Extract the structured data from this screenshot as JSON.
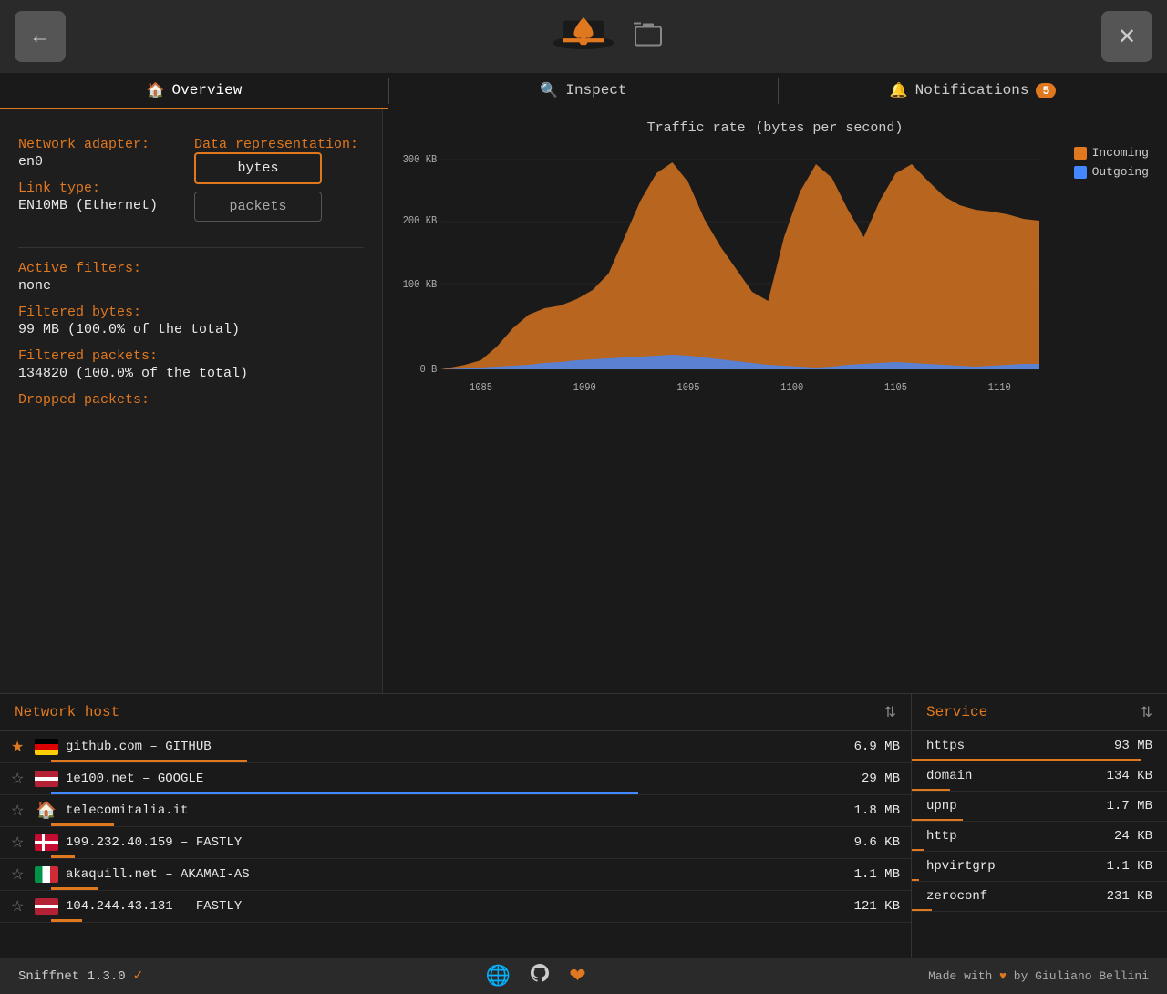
{
  "header": {
    "back_button_label": "←",
    "settings_button_label": "✕",
    "capture_icon_label": "⊞"
  },
  "tabs": [
    {
      "id": "overview",
      "label": "Overview",
      "icon": "🏠",
      "active": true,
      "badge": null
    },
    {
      "id": "inspect",
      "label": "Inspect",
      "icon": "🔍",
      "active": false,
      "badge": null
    },
    {
      "id": "notifications",
      "label": "Notifications",
      "icon": "🔔",
      "active": false,
      "badge": "5"
    }
  ],
  "left_panel": {
    "network_adapter_label": "Network adapter:",
    "network_adapter_value": "en0",
    "link_type_label": "Link type:",
    "link_type_value": "EN10MB (Ethernet)",
    "data_representation_label": "Data representation:",
    "bytes_btn": "bytes",
    "packets_btn": "packets",
    "active_filters_label": "Active filters:",
    "active_filters_value": "none",
    "filtered_bytes_label": "Filtered bytes:",
    "filtered_bytes_value": "99 MB (100.0% of the total)",
    "filtered_packets_label": "Filtered packets:",
    "filtered_packets_value": "134820 (100.0% of the total)",
    "dropped_packets_label": "Dropped packets:"
  },
  "chart": {
    "title": "Traffic rate",
    "subtitle": "(bytes per second)",
    "legend": [
      {
        "label": "Incoming",
        "color": "#e07820"
      },
      {
        "label": "Outgoing",
        "color": "#4488ff"
      }
    ],
    "y_labels": [
      "300 KB",
      "200 KB",
      "100 KB",
      "0 B"
    ],
    "x_labels": [
      "1085",
      "1090",
      "1095",
      "1100",
      "1105",
      "1110"
    ]
  },
  "network_hosts": {
    "title": "Network host",
    "rows": [
      {
        "starred": true,
        "flag": "de",
        "name": "github.com – GITHUB",
        "size": "6.9 MB",
        "bar_pct": 25,
        "bar_type": "orange"
      },
      {
        "starred": false,
        "flag": "us",
        "name": "1e100.net – GOOGLE",
        "size": "29 MB",
        "bar_pct": 75,
        "bar_type": "blue"
      },
      {
        "starred": false,
        "flag": "house",
        "name": "telecomitalia.it",
        "size": "1.8 MB",
        "bar_pct": 8,
        "bar_type": "orange"
      },
      {
        "starred": false,
        "flag": "dk",
        "name": "199.232.40.159 – FASTLY",
        "size": "9.6 KB",
        "bar_pct": 3,
        "bar_type": "orange"
      },
      {
        "starred": false,
        "flag": "it",
        "name": "akaquill.net – AKAMAI-AS",
        "size": "1.1 MB",
        "bar_pct": 6,
        "bar_type": "orange"
      },
      {
        "starred": false,
        "flag": "us",
        "name": "104.244.43.131 – FASTLY",
        "size": "121 KB",
        "bar_pct": 4,
        "bar_type": "orange"
      }
    ]
  },
  "services": {
    "title": "Service",
    "rows": [
      {
        "name": "https",
        "size": "93 MB",
        "bar_pct": 90
      },
      {
        "name": "domain",
        "size": "134 KB",
        "bar_pct": 15
      },
      {
        "name": "upnp",
        "size": "1.7 MB",
        "bar_pct": 20
      },
      {
        "name": "http",
        "size": "24 KB",
        "bar_pct": 5
      },
      {
        "name": "hpvirtgrp",
        "size": "1.1 KB",
        "bar_pct": 3
      },
      {
        "name": "zeroconf",
        "size": "231 KB",
        "bar_pct": 8
      }
    ]
  },
  "footer": {
    "app_name": "Sniffnet 1.3.0",
    "check_icon": "✓",
    "made_with": "Made with",
    "heart": "♥",
    "by": "by Giuliano Bellini"
  }
}
